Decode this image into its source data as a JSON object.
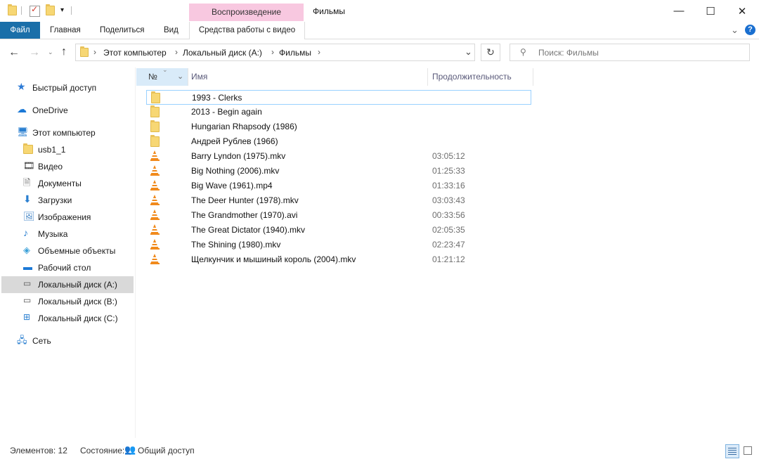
{
  "window": {
    "title": "Фильмы",
    "contextual_tab_header": "Воспроизведение",
    "minimize_glyph": "—",
    "maximize_glyph": "☐",
    "close_glyph": "✕"
  },
  "ribbon": {
    "tabs": [
      {
        "label": "Файл"
      },
      {
        "label": "Главная"
      },
      {
        "label": "Поделиться"
      },
      {
        "label": "Вид"
      },
      {
        "label": "Средства работы с видео"
      }
    ],
    "collapse_glyph": "⌄",
    "help_glyph": "?"
  },
  "address": {
    "breadcrumbs": [
      "Этот компьютер",
      "Локальный диск (A:)",
      "Фильмы"
    ],
    "separator": "›",
    "dropdown_glyph": "⌄",
    "refresh_glyph": "↻"
  },
  "search": {
    "placeholder": "Поиск: Фильмы"
  },
  "sidebar": {
    "items": [
      {
        "label": "Быстрый доступ",
        "icon": "star-icon"
      },
      {
        "label": "OneDrive",
        "icon": "cloud-icon"
      },
      {
        "label": "Этот компьютер",
        "icon": "computer-icon"
      },
      {
        "label": "usb1_1",
        "icon": "folder-icon"
      },
      {
        "label": "Видео",
        "icon": "film-icon"
      },
      {
        "label": "Документы",
        "icon": "document-icon"
      },
      {
        "label": "Загрузки",
        "icon": "download-icon"
      },
      {
        "label": "Изображения",
        "icon": "picture-icon"
      },
      {
        "label": "Музыка",
        "icon": "music-icon"
      },
      {
        "label": "Объемные объекты",
        "icon": "cube-icon"
      },
      {
        "label": "Рабочий стол",
        "icon": "desktop-icon"
      },
      {
        "label": "Локальный диск (A:)",
        "icon": "drive-icon",
        "selected": true
      },
      {
        "label": "Локальный диск (B:)",
        "icon": "drive-icon"
      },
      {
        "label": "Локальный диск (C:)",
        "icon": "windows-drive-icon"
      },
      {
        "label": "Сеть",
        "icon": "network-icon"
      }
    ]
  },
  "columns": {
    "num": "№",
    "name": "Имя",
    "duration": "Продолжительность"
  },
  "files": [
    {
      "name": "1993 - Clerks",
      "type": "folder",
      "duration": ""
    },
    {
      "name": "2013 - Begin again",
      "type": "folder",
      "duration": ""
    },
    {
      "name": "Hungarian Rhapsody (1986)",
      "type": "folder",
      "duration": ""
    },
    {
      "name": "Андрей Рублев (1966)",
      "type": "folder",
      "duration": ""
    },
    {
      "name": "Barry Lyndon (1975).mkv",
      "type": "video",
      "duration": "03:05:12"
    },
    {
      "name": "Big Nothing (2006).mkv",
      "type": "video",
      "duration": "01:25:33"
    },
    {
      "name": "Big Wave (1961).mp4",
      "type": "video",
      "duration": "01:33:16"
    },
    {
      "name": "The Deer Hunter (1978).mkv",
      "type": "video",
      "duration": "03:03:43"
    },
    {
      "name": "The Grandmother (1970).avi",
      "type": "video",
      "duration": "00:33:56"
    },
    {
      "name": "The Great Dictator (1940).mkv",
      "type": "video",
      "duration": "02:05:35"
    },
    {
      "name": "The Shining (1980).mkv",
      "type": "video",
      "duration": "02:23:47"
    },
    {
      "name": "Щелкунчик и мышиный король (2004).mkv",
      "type": "video",
      "duration": "01:21:12"
    }
  ],
  "status": {
    "items_count": "Элементов: 12",
    "state_label": "Состояние:",
    "state_value": "Общий доступ"
  }
}
